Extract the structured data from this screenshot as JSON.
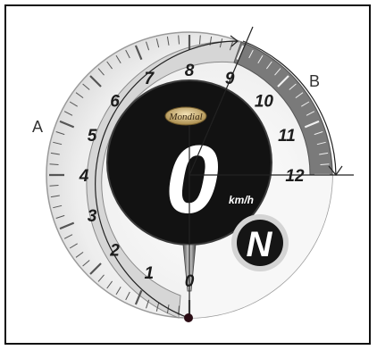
{
  "gauge": {
    "scale_labels": [
      "0",
      "1",
      "2",
      "3",
      "4",
      "5",
      "6",
      "7",
      "8",
      "9",
      "10",
      "11",
      "12"
    ],
    "speed_value": "0",
    "speed_unit": "km/h",
    "gear_indicator": "N",
    "brand": "Mondial"
  },
  "callouts": {
    "a": "A",
    "b": "B"
  },
  "colors": {
    "dial_center": "#111111",
    "ring_light": "#d9d9d9",
    "ring_dark": "#6a6a6a",
    "leader_line": "#222222"
  }
}
